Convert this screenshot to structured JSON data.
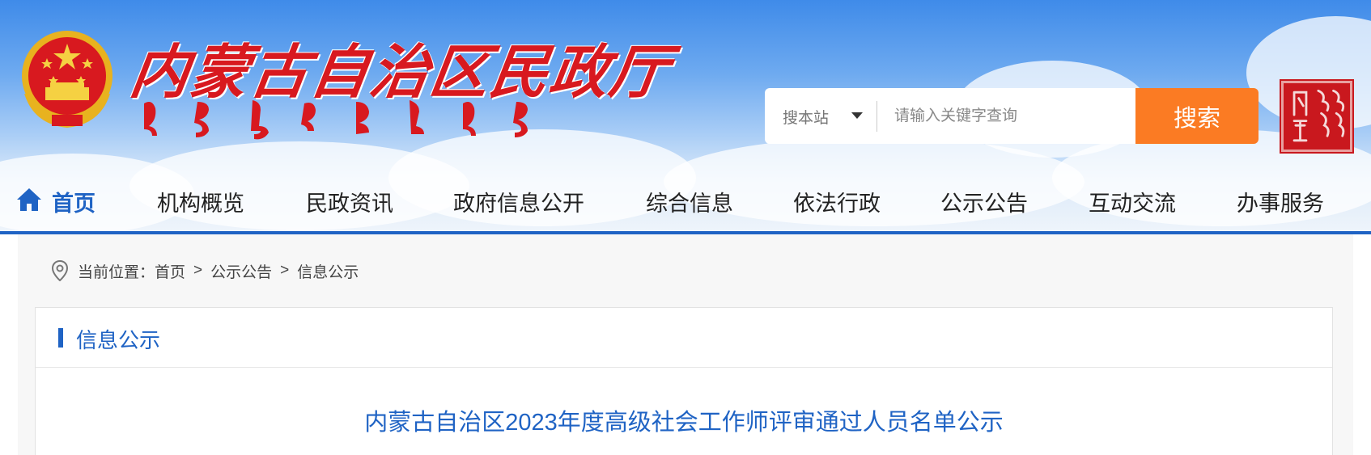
{
  "header": {
    "site_title": "内蒙古自治区民政厅",
    "search": {
      "scope_label": "搜本站",
      "placeholder": "请输入关键字查询",
      "button_label": "搜索"
    }
  },
  "nav": {
    "items": [
      {
        "label": "首页",
        "active": true
      },
      {
        "label": "机构概览"
      },
      {
        "label": "民政资讯"
      },
      {
        "label": "政府信息公开"
      },
      {
        "label": "综合信息"
      },
      {
        "label": "依法行政"
      },
      {
        "label": "公示公告"
      },
      {
        "label": "互动交流"
      },
      {
        "label": "办事服务"
      }
    ]
  },
  "breadcrumb": {
    "prefix": "当前位置：",
    "items": [
      "首页",
      "公示公告",
      "信息公示"
    ],
    "separator": ">"
  },
  "panel": {
    "heading": "信息公示",
    "article_title": "内蒙古自治区2023年度高级社会工作师评审通过人员名单公示"
  },
  "colors": {
    "accent_blue": "#1f63c4",
    "search_orange": "#fb7b23",
    "title_red": "#d8191f"
  }
}
